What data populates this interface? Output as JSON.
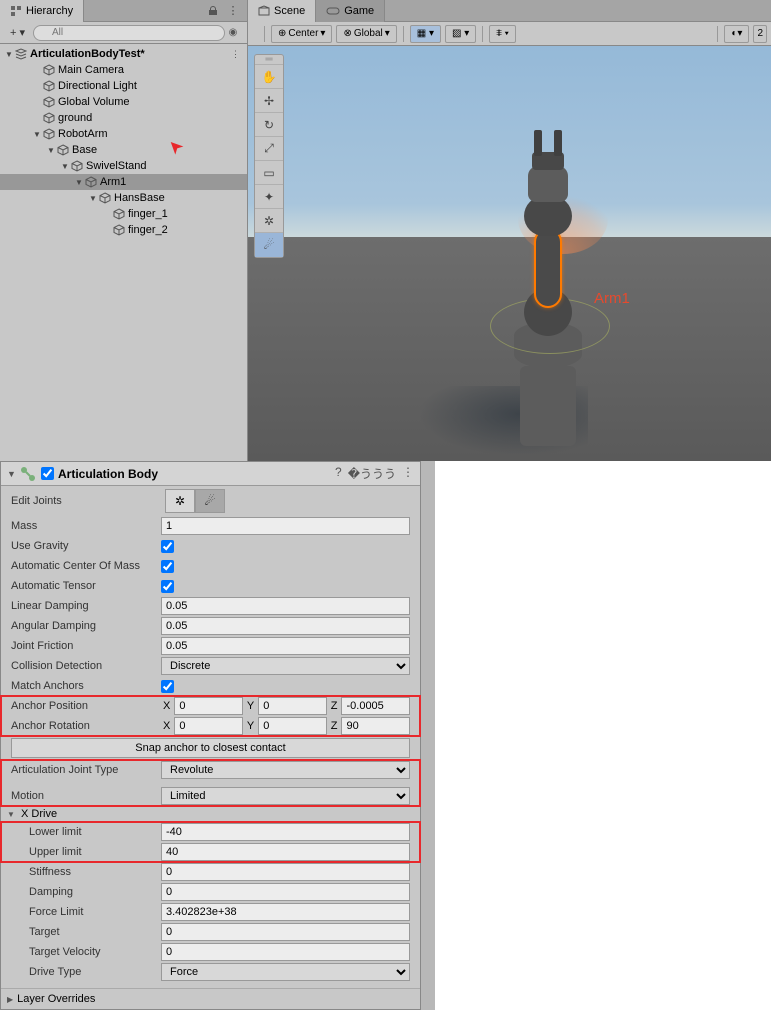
{
  "hierarchy": {
    "tab": "Hierarchy",
    "search_placeholder": "All",
    "scene": "ArticulationBodyTest*",
    "items": [
      {
        "label": "Main Camera",
        "indent": 2
      },
      {
        "label": "Directional Light",
        "indent": 2
      },
      {
        "label": "Global Volume",
        "indent": 2
      },
      {
        "label": "ground",
        "indent": 2
      },
      {
        "label": "RobotArm",
        "indent": 2,
        "expandable": true
      },
      {
        "label": "Base",
        "indent": 3,
        "expandable": true
      },
      {
        "label": "SwivelStand",
        "indent": 4,
        "expandable": true
      },
      {
        "label": "Arm1",
        "indent": 5,
        "expandable": true,
        "selected": true
      },
      {
        "label": "HansBase",
        "indent": 6,
        "expandable": true
      },
      {
        "label": "finger_1",
        "indent": 7
      },
      {
        "label": "finger_2",
        "indent": 7
      }
    ]
  },
  "scene": {
    "tab_scene": "Scene",
    "tab_game": "Game",
    "pivot_mode": "Center",
    "space_mode": "Global",
    "annotation": "Arm1"
  },
  "inspector": {
    "component": "Articulation Body",
    "edit_joints_label": "Edit Joints",
    "mass": {
      "label": "Mass",
      "value": "1"
    },
    "use_gravity": {
      "label": "Use Gravity",
      "value": true
    },
    "auto_com": {
      "label": "Automatic Center Of Mass",
      "value": true
    },
    "auto_tensor": {
      "label": "Automatic Tensor",
      "value": true
    },
    "linear_damping": {
      "label": "Linear Damping",
      "value": "0.05"
    },
    "angular_damping": {
      "label": "Angular Damping",
      "value": "0.05"
    },
    "joint_friction": {
      "label": "Joint Friction",
      "value": "0.05"
    },
    "collision_detection": {
      "label": "Collision Detection",
      "value": "Discrete"
    },
    "match_anchors": {
      "label": "Match Anchors",
      "value": true
    },
    "anchor_pos": {
      "label": "Anchor Position",
      "x": "0",
      "y": "0",
      "z": "-0.0005"
    },
    "anchor_rot": {
      "label": "Anchor Rotation",
      "x": "0",
      "y": "0",
      "z": "90"
    },
    "snap_button": "Snap anchor to closest contact",
    "joint_type": {
      "label": "Articulation Joint Type",
      "value": "Revolute"
    },
    "motion": {
      "label": "Motion",
      "value": "Limited"
    },
    "xdrive_header": "X Drive",
    "lower_limit": {
      "label": "Lower limit",
      "value": "-40"
    },
    "upper_limit": {
      "label": "Upper limit",
      "value": "40"
    },
    "stiffness": {
      "label": "Stiffness",
      "value": "0"
    },
    "damping": {
      "label": "Damping",
      "value": "0"
    },
    "force_limit": {
      "label": "Force Limit",
      "value": "3.402823e+38"
    },
    "target": {
      "label": "Target",
      "value": "0"
    },
    "target_velocity": {
      "label": "Target Velocity",
      "value": "0"
    },
    "drive_type": {
      "label": "Drive Type",
      "value": "Force"
    },
    "layer_overrides": "Layer Overrides"
  }
}
